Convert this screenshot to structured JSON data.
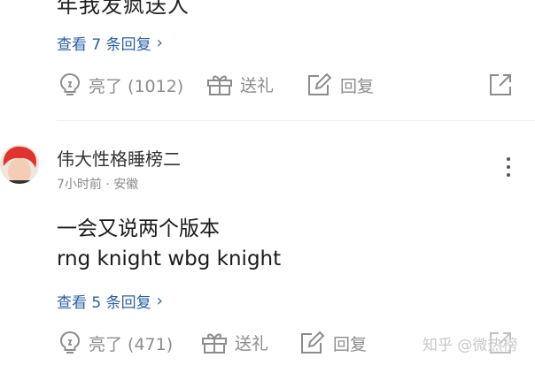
{
  "comment_prev": {
    "cut_text": "年我发疯送人",
    "view_replies": "查看 7 条回复",
    "actions": {
      "like_label": "亮了 (1012)",
      "gift_label": "送礼",
      "reply_label": "回复"
    }
  },
  "comment": {
    "username": "伟大性格睡榜二",
    "meta": "7小时前 · 安徽",
    "lines": [
      "一会又说两个版本",
      "rng knight wbg knight"
    ],
    "view_replies": "查看 5 条回复",
    "actions": {
      "like_label": "亮了 (471)",
      "gift_label": "送礼",
      "reply_label": "回复"
    }
  },
  "watermark": "知乎 @微热榜",
  "colors": {
    "link_blue": "#2c5fa8",
    "action_gray": "#8c8c8c",
    "avatar_hair": "#e0332d"
  },
  "icons": [
    "bulb-icon",
    "gift-icon",
    "edit-icon",
    "share-icon",
    "more-vertical-icon",
    "chevron-right-icon"
  ]
}
